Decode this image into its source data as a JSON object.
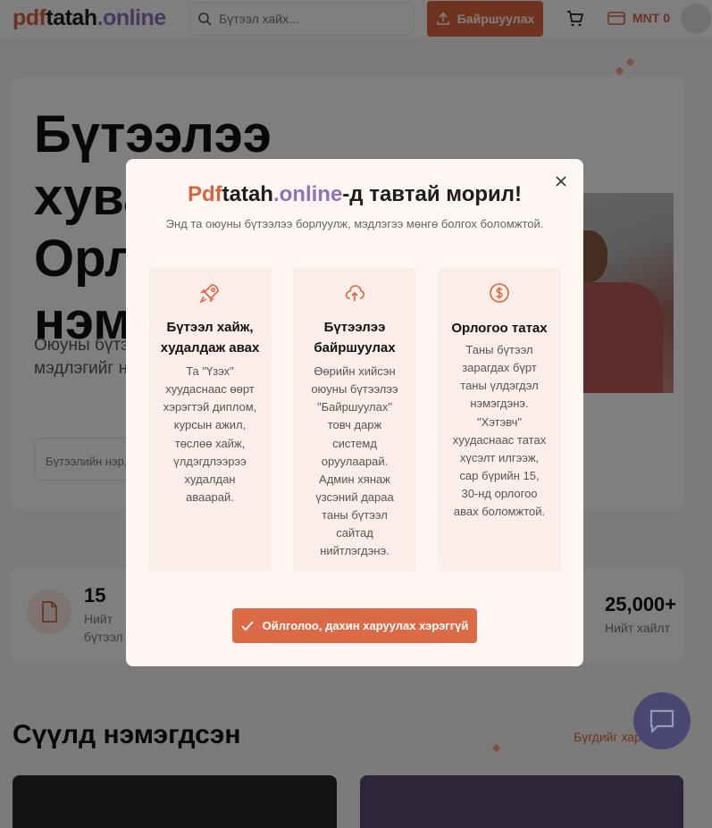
{
  "header": {
    "logo": {
      "part1": "pdf",
      "part2": "tatah",
      "part3": ".online"
    },
    "search_placeholder": "Бүтээл хайх...",
    "upload_label": "Байршуулах",
    "wallet_label": "MNT 0"
  },
  "hero": {
    "title_lines": [
      "Бүтээлээ",
      "хуваалц,",
      "Орлого",
      "нэмэгдүүл"
    ],
    "subtitle": "Оюуны бүтээлээ борлуулж, өөрийн мэдлэгийг нэг дороос",
    "search_placeholder": "Бүтээлийн нэр, "
  },
  "stats": [
    {
      "value": "15",
      "label": "Нийт бүтээл"
    },
    {
      "value": "25,000+",
      "label": "Нийт хайлт"
    }
  ],
  "recent": {
    "title": "Сүүлд нэмэгдсэн",
    "see_all": "Бүгдийг харах"
  },
  "modal": {
    "title_brand": {
      "part1": "Pdf",
      "part2": "tatah",
      "part3": ".online"
    },
    "title_rest": "-д тавтай морил!",
    "subtitle": "Энд та оюуны бүтээлээ борлуулж, мэдлэгээ мөнгө болгох боломжтой.",
    "features": [
      {
        "icon": "rocket-icon",
        "title": "Бүтээл хайж, худалдаж авах",
        "desc": "Та \"Үзэх\" хуудаснаас өөрт хэрэгтэй диплом, курсын ажил, төслөө хайж, үлдэгдлээрээ худалдан аваарай."
      },
      {
        "icon": "cloud-upload-icon",
        "title": "Бүтээлээ байршуулах",
        "desc": "Өөрийн хийсэн оюуны бүтээлээ \"Байршуулах\" товч дарж системд оруулаарай. Админ хянаж үзсэний дараа таны бүтээл сайтад нийтлэгдэнэ."
      },
      {
        "icon": "dollar-circle-icon",
        "title": "Орлогоо татах",
        "desc": "Таны бүтээл зарагдах бүрт таны үлдэгдэл нэмэгдэнэ. \"Хэтэвч\" хуудаснаас татах хүсэлт илгээж, сар бүрийн 15, 30-нд орлогоо авах боломжтой."
      }
    ],
    "confirm_label": "Ойлголоо, дахин харуулах хэрэггүй"
  },
  "colors": {
    "accent": "#d8653f",
    "purple": "#8f72b8",
    "modal_bg": "#fdf6f2",
    "card_bg": "#fbeee8"
  }
}
